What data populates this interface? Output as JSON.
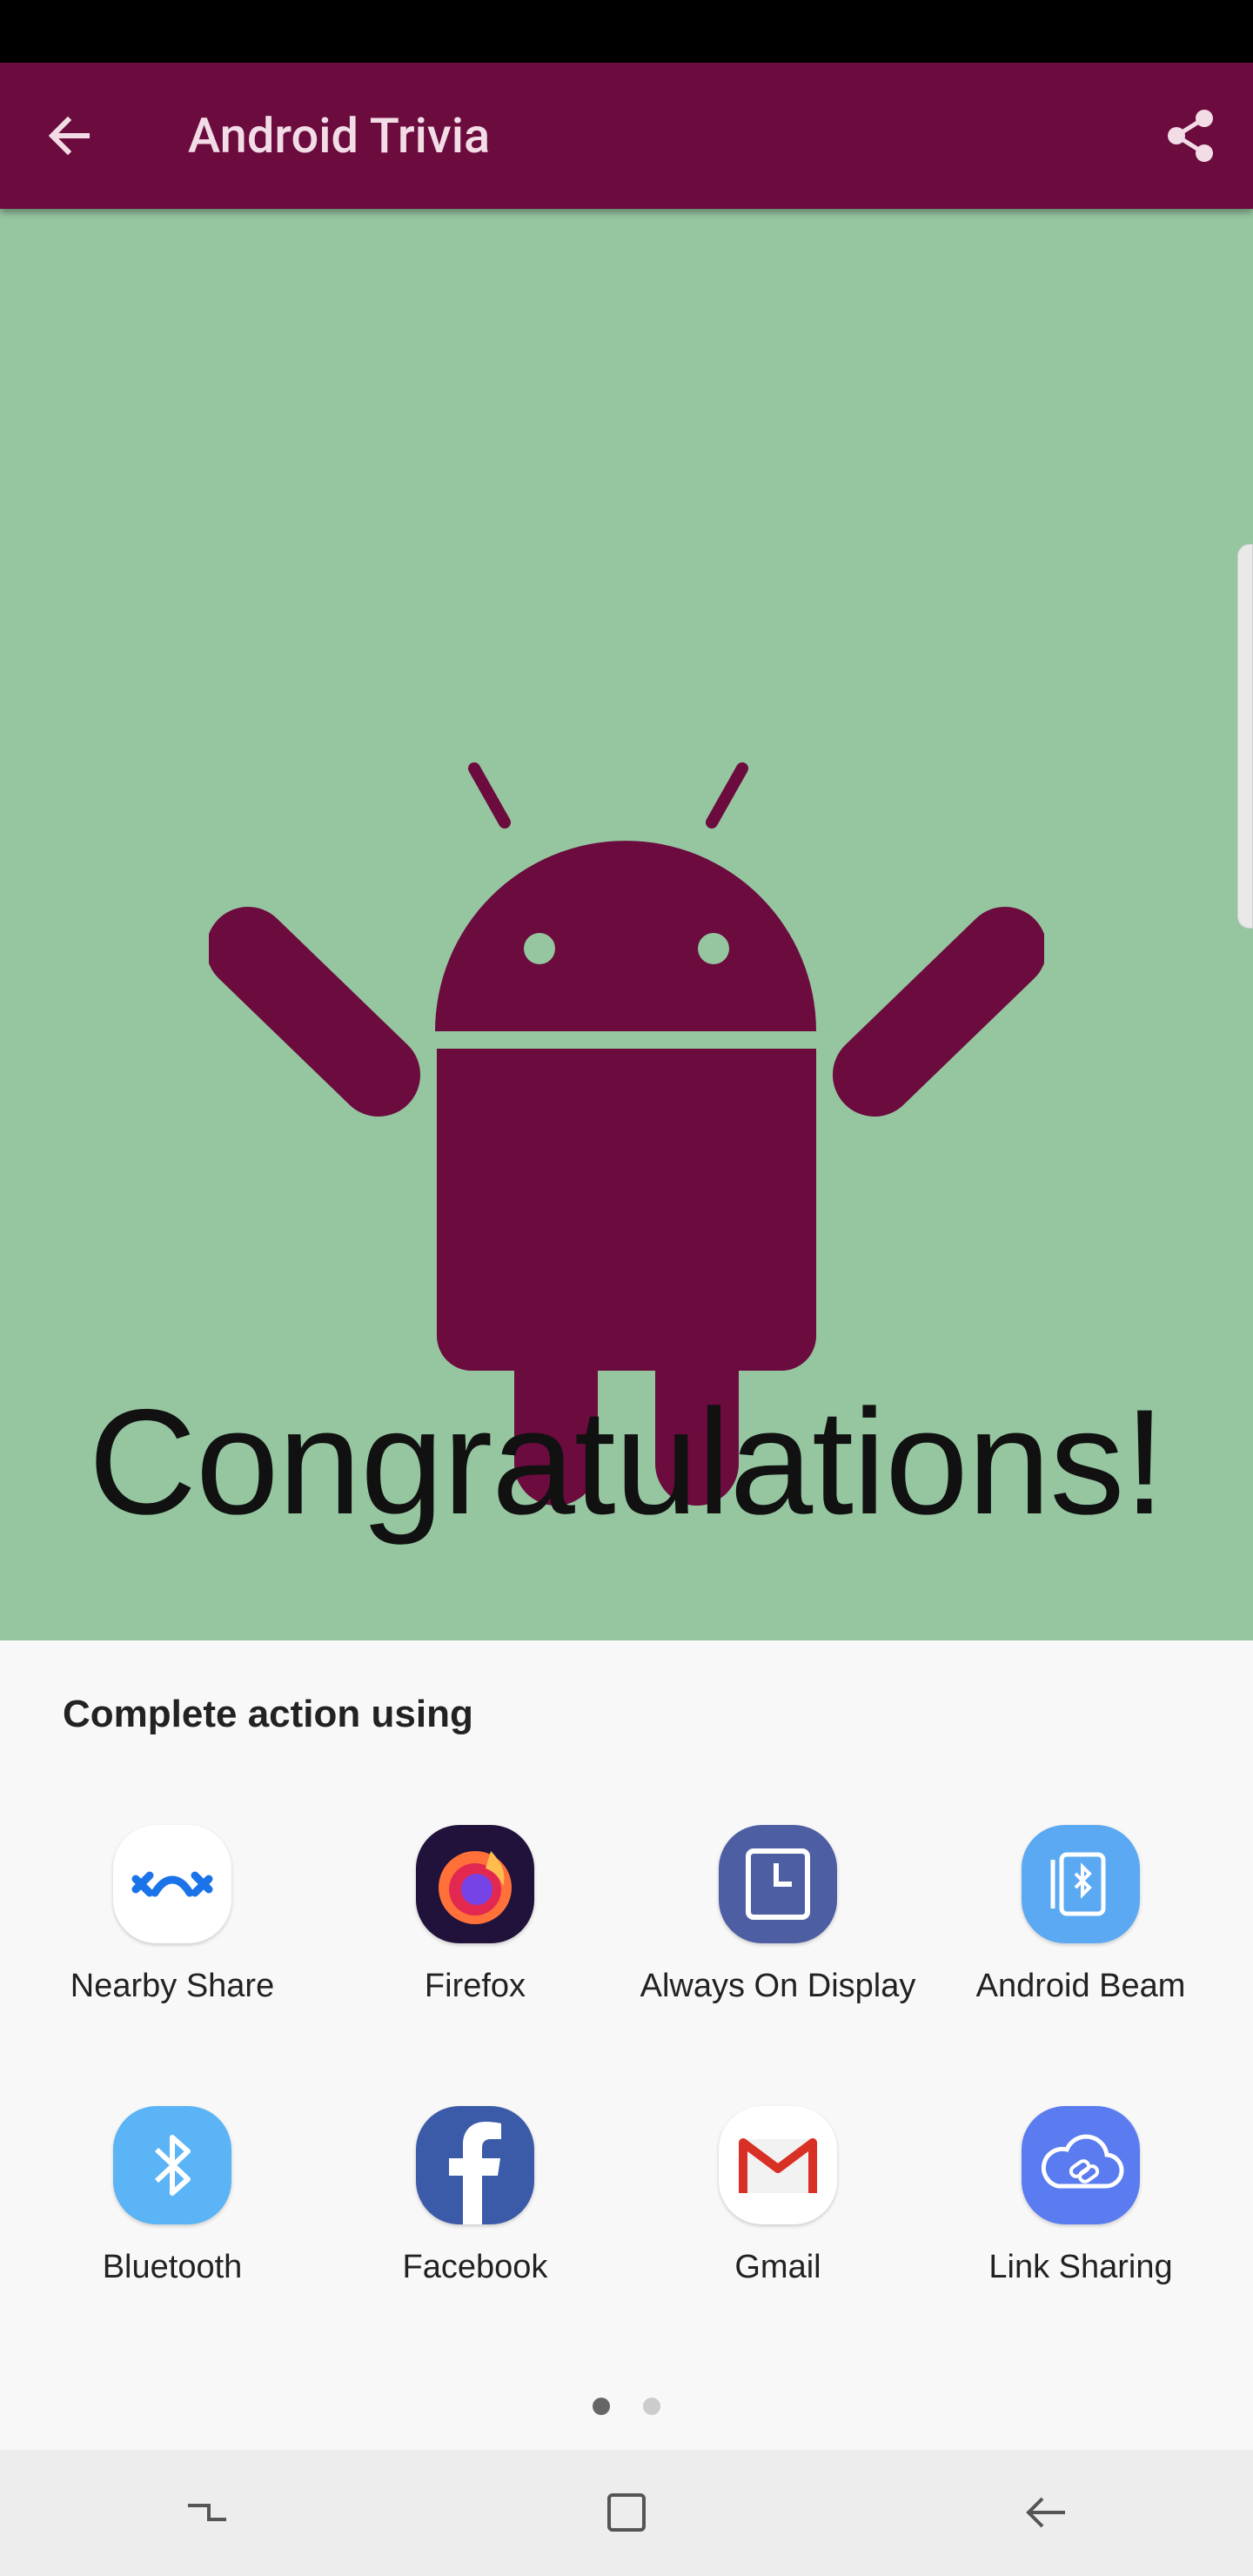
{
  "app_bar": {
    "title": "Android Trivia",
    "back_icon": "arrow-back-icon",
    "share_icon": "share-icon",
    "color": "#6b0b3e"
  },
  "main": {
    "background": "#95c6a0",
    "illustration": "android-robot-celebrating",
    "headline": "Congratulations!"
  },
  "share_sheet": {
    "title": "Complete action using",
    "apps": [
      {
        "label": "Nearby Share",
        "icon": "nearby-share-icon"
      },
      {
        "label": "Firefox",
        "icon": "firefox-icon"
      },
      {
        "label": "Always On Display",
        "icon": "always-on-display-icon"
      },
      {
        "label": "Android Beam",
        "icon": "android-beam-icon"
      },
      {
        "label": "Bluetooth",
        "icon": "bluetooth-icon"
      },
      {
        "label": "Facebook",
        "icon": "facebook-icon"
      },
      {
        "label": "Gmail",
        "icon": "gmail-icon"
      },
      {
        "label": "Link Sharing",
        "icon": "link-sharing-icon"
      }
    ],
    "page_count": 2,
    "current_page": 1
  },
  "navigation_bar": {
    "buttons": [
      "recents-icon",
      "home-icon",
      "back-icon"
    ]
  }
}
